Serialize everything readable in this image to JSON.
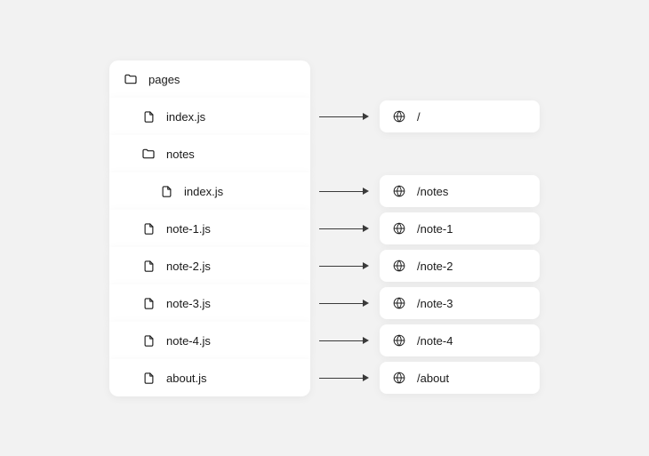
{
  "tree": {
    "items": [
      {
        "type": "folder",
        "label": "pages",
        "indent": 0,
        "route": null
      },
      {
        "type": "file",
        "label": "index.js",
        "indent": 1,
        "route": "/"
      },
      {
        "type": "folder",
        "label": "notes",
        "indent": 1,
        "route": null
      },
      {
        "type": "file",
        "label": "index.js",
        "indent": 2,
        "route": "/notes"
      },
      {
        "type": "file",
        "label": "note-1.js",
        "indent": 1,
        "route": "/note-1"
      },
      {
        "type": "file",
        "label": "note-2.js",
        "indent": 1,
        "route": "/note-2"
      },
      {
        "type": "file",
        "label": "note-3.js",
        "indent": 1,
        "route": "/note-3"
      },
      {
        "type": "file",
        "label": "note-4.js",
        "indent": 1,
        "route": "/note-4"
      },
      {
        "type": "file",
        "label": "about.js",
        "indent": 1,
        "route": "/about"
      }
    ]
  }
}
